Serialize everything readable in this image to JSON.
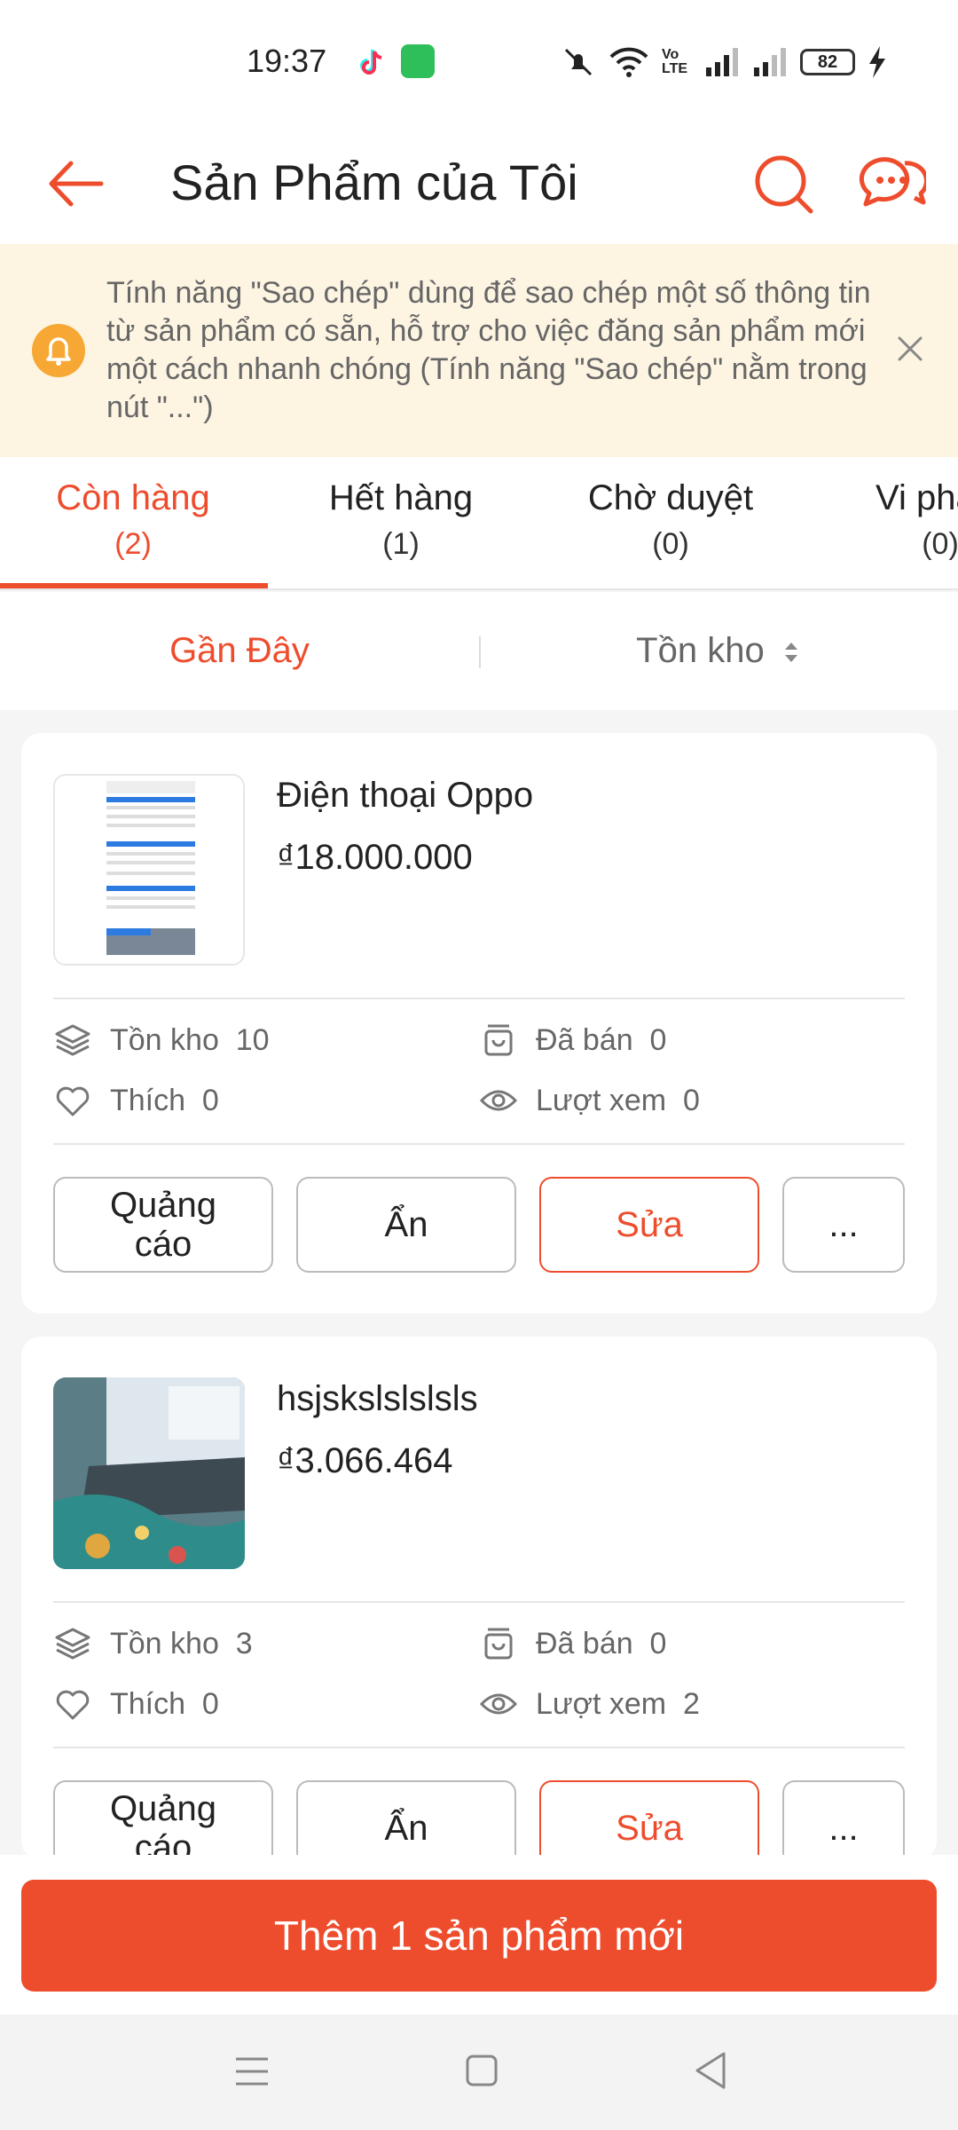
{
  "status_bar": {
    "time": "19:37",
    "battery": "82",
    "volte": "Vo LTE"
  },
  "header": {
    "title": "Sản Phẩm của Tôi"
  },
  "banner": {
    "text": "Tính năng \"Sao chép\" dùng để sao chép một số thông tin từ sản phẩm có sẵn, hỗ trợ cho việc đăng sản phẩm mới một cách nhanh chóng (Tính năng \"Sao chép\" nằm trong nút \"...\")"
  },
  "tabs": [
    {
      "label": "Còn hàng",
      "count": "(2)"
    },
    {
      "label": "Hết hàng",
      "count": "(1)"
    },
    {
      "label": "Chờ duyệt",
      "count": "(0)"
    },
    {
      "label": "Vi phạm",
      "count": "(0)"
    }
  ],
  "sort": {
    "recent": "Gần Đây",
    "stock": "Tồn kho"
  },
  "products": [
    {
      "name": "Điện thoại Oppo",
      "price": "₫18.000.000",
      "stock": "Tồn kho  10",
      "sold": "Đã bán  0",
      "likes": "Thích  0",
      "views": "Lượt xem  0"
    },
    {
      "name": "hsjskslslslsls",
      "price": "₫3.066.464",
      "stock": "Tồn kho  3",
      "sold": "Đã bán  0",
      "likes": "Thích  0",
      "views": "Lượt xem  2"
    }
  ],
  "actions": {
    "ads": "Quảng cáo",
    "hide": "Ẩn",
    "edit": "Sửa",
    "more": "..."
  },
  "add_button": "Thêm 1 sản phẩm mới",
  "colors": {
    "accent": "#ee4d2d",
    "banner_bg": "#fdf4e2"
  }
}
